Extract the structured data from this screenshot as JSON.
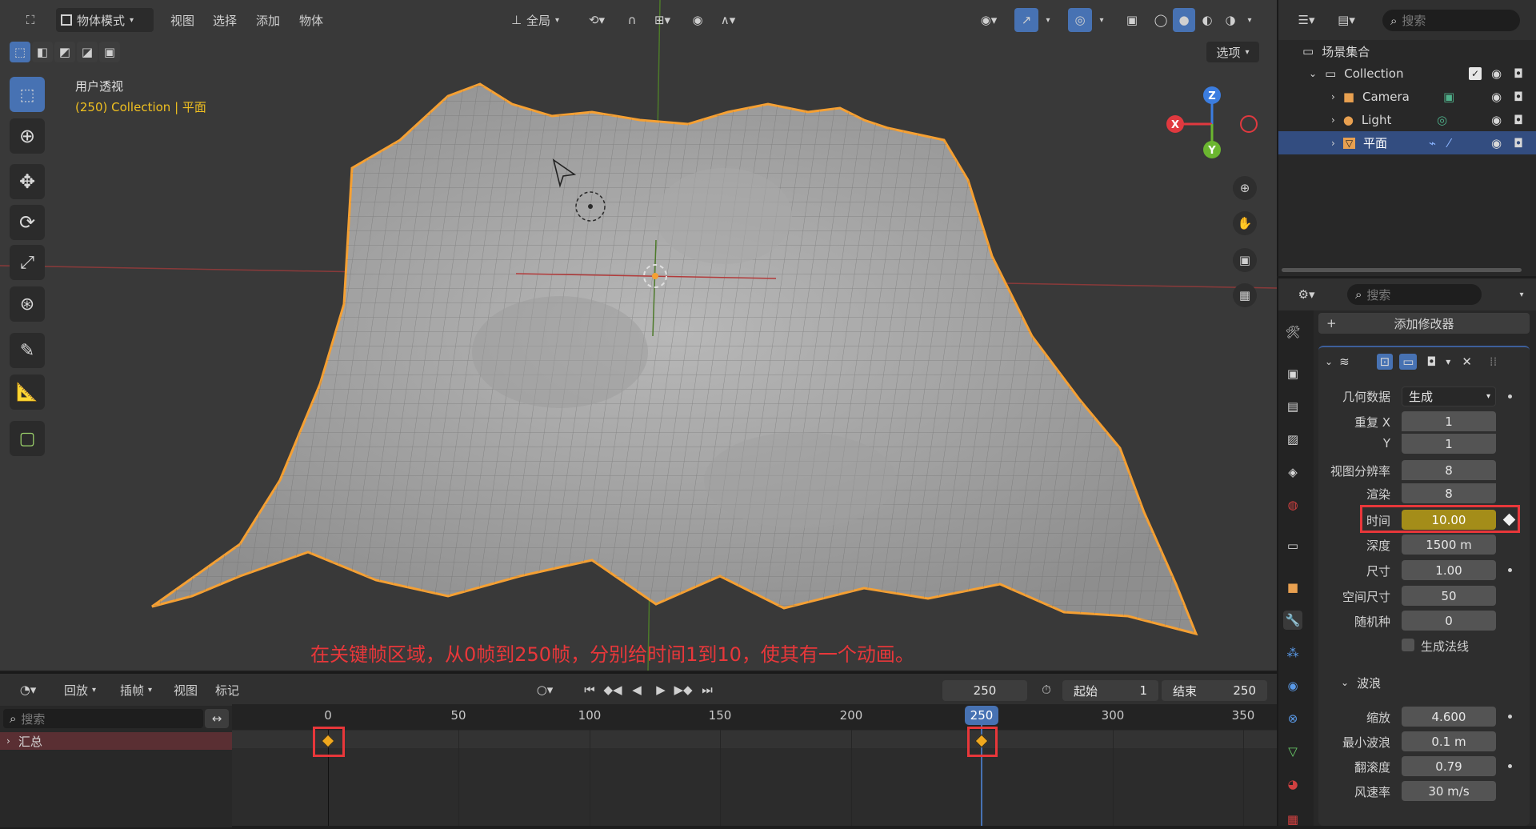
{
  "header": {
    "mode": "物体模式",
    "menus": [
      "视图",
      "选择",
      "添加",
      "物体"
    ],
    "orientation": "全局",
    "options": "选项"
  },
  "viewport": {
    "view_name": "用户透视",
    "collection_info": "(250) Collection | 平面",
    "annotation": "在关键帧区域，从0帧到250帧，分别给时间1到10，使其有一个动画。",
    "gizmo": {
      "x": "X",
      "y": "Y",
      "z": "Z"
    },
    "colors": {
      "selection": "#f5a033",
      "background": "#393939",
      "highlight_box": "#e8373a"
    }
  },
  "outliner": {
    "search_placeholder": "搜索",
    "root": "场景集合",
    "items": [
      {
        "name": "Collection"
      },
      {
        "name": "Camera"
      },
      {
        "name": "Light"
      },
      {
        "name": "平面",
        "selected": true
      }
    ]
  },
  "properties": {
    "search_placeholder": "搜索",
    "add_modifier": "添加修改器",
    "fields": [
      {
        "label": "几何数据",
        "value": "生成",
        "type": "select"
      },
      {
        "label": "重复 X",
        "value": "1"
      },
      {
        "label": "Y",
        "value": "1"
      },
      {
        "label": "视图分辨率",
        "value": "8"
      },
      {
        "label": "渲染",
        "value": "8"
      },
      {
        "label": "时间",
        "value": "10.00",
        "keyed": true
      },
      {
        "label": "深度",
        "value": "1500 m"
      },
      {
        "label": "尺寸",
        "value": "1.00"
      },
      {
        "label": "空间尺寸",
        "value": "50"
      },
      {
        "label": "随机种",
        "value": "0"
      }
    ],
    "checkbox_label": "生成法线",
    "subpanel": "波浪",
    "wave_fields": [
      {
        "label": "缩放",
        "value": "4.600"
      },
      {
        "label": "最小波浪",
        "value": "0.1 m"
      },
      {
        "label": "翻滚度",
        "value": "0.79"
      },
      {
        "label": "风速率",
        "value": "30 m/s"
      }
    ]
  },
  "timeline": {
    "menus": [
      "回放",
      "插帧",
      "视图",
      "标记"
    ],
    "current_frame": "250",
    "start_label": "起始",
    "start": "1",
    "end_label": "结束",
    "end": "250",
    "search_placeholder": "搜索",
    "channel": "汇总",
    "ticks": [
      "0",
      "50",
      "100",
      "150",
      "200",
      "250",
      "300",
      "350"
    ],
    "keyframes": [
      0,
      250
    ]
  }
}
